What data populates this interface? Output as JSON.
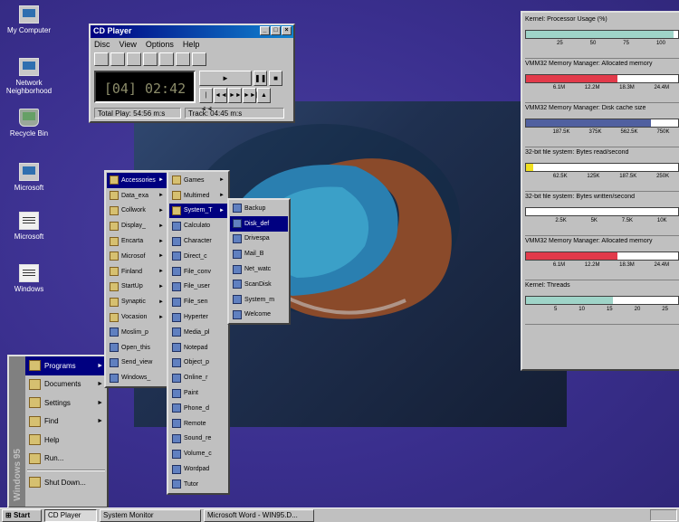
{
  "desktop": {
    "icons": [
      {
        "label": "My Computer"
      },
      {
        "label": "Network Neighborhood"
      },
      {
        "label": "Recycle Bin"
      },
      {
        "label": "Microsoft"
      },
      {
        "label": "Microsoft"
      },
      {
        "label": "Windows"
      }
    ]
  },
  "cd_player": {
    "title": "CD Player",
    "menu": [
      "Disc",
      "View",
      "Options",
      "Help"
    ],
    "display": "[04] 02:42",
    "status_total": "Total Play: 54:56 m:s",
    "status_track": "Track: 04:45 m:s"
  },
  "system_monitor": {
    "panels": [
      {
        "label": "Kernel: Processor Usage (%)",
        "ticks": [
          "25",
          "50",
          "75",
          "100"
        ],
        "fill": 0.97,
        "color": "#9fd4c8"
      },
      {
        "label": "VMM32 Memory Manager: Allocated memory",
        "ticks": [
          "6.1M",
          "12.2M",
          "18.3M",
          "24.4M"
        ],
        "fill": 0.6,
        "color": "#e23a4a"
      },
      {
        "label": "VMM32 Memory Manager: Disk cache size",
        "ticks": [
          "187.5K",
          "375K",
          "562.5K",
          "750K"
        ],
        "fill": 0.82,
        "color": "#5060a0"
      },
      {
        "label": "32-bit file system: Bytes read/second",
        "ticks": [
          "62.5K",
          "125K",
          "187.5K",
          "250K"
        ],
        "fill": 0.05,
        "color": "#f0e020"
      },
      {
        "label": "32-bit file system: Bytes written/second",
        "ticks": [
          "2.5K",
          "5K",
          "7.5K",
          "10K"
        ],
        "fill": 0.0,
        "color": "#9fd4c8"
      },
      {
        "label": "VMM32 Memory Manager: Allocated memory",
        "ticks": [
          "6.1M",
          "12.2M",
          "18.3M",
          "24.4M"
        ],
        "fill": 0.6,
        "color": "#e23a4a"
      },
      {
        "label": "Kernel: Threads",
        "ticks": [
          "5",
          "10",
          "15",
          "20",
          "25"
        ],
        "fill": 0.57,
        "color": "#9fd4c8"
      }
    ]
  },
  "start_menu": {
    "side_text": "Windows 95",
    "items": [
      {
        "label": "Programs",
        "arrow": true,
        "highlight": true
      },
      {
        "label": "Documents",
        "arrow": true
      },
      {
        "label": "Settings",
        "arrow": true
      },
      {
        "label": "Find",
        "arrow": true
      },
      {
        "label": "Help"
      },
      {
        "label": "Run..."
      },
      {
        "label": "Shut Down..."
      }
    ]
  },
  "programs_menu": {
    "items": [
      {
        "label": "Accessories",
        "arrow": true,
        "highlight": true
      },
      {
        "label": "Data_exa",
        "arrow": true
      },
      {
        "label": "Collwork",
        "arrow": true
      },
      {
        "label": "Display_",
        "arrow": true
      },
      {
        "label": "Encarta",
        "arrow": true
      },
      {
        "label": "Microsof",
        "arrow": true
      },
      {
        "label": "Finland",
        "arrow": true
      },
      {
        "label": "StartUp",
        "arrow": true
      },
      {
        "label": "Synaptic",
        "arrow": true
      },
      {
        "label": "Vocasion",
        "arrow": true
      },
      {
        "label": "Moslim_p"
      },
      {
        "label": "Open_this"
      },
      {
        "label": "Send_view"
      },
      {
        "label": "Windows_"
      }
    ]
  },
  "accessories_menu": {
    "items": [
      {
        "label": "Games",
        "arrow": true
      },
      {
        "label": "Multimed",
        "arrow": true
      },
      {
        "label": "System_T",
        "arrow": true,
        "highlight": true
      },
      {
        "label": "Calculato"
      },
      {
        "label": "Character"
      },
      {
        "label": "Direct_c"
      },
      {
        "label": "File_conv"
      },
      {
        "label": "File_user"
      },
      {
        "label": "File_sen"
      },
      {
        "label": "Hyperter"
      },
      {
        "label": "Media_pl"
      },
      {
        "label": "Notepad"
      },
      {
        "label": "Object_p"
      },
      {
        "label": "Online_r"
      },
      {
        "label": "Paint"
      },
      {
        "label": "Phone_d"
      },
      {
        "label": "Remote"
      },
      {
        "label": "Sound_re"
      },
      {
        "label": "Volume_c"
      },
      {
        "label": "Wordpad"
      },
      {
        "label": "Tutor"
      }
    ]
  },
  "system_tools_menu": {
    "items": [
      {
        "label": "Backup"
      },
      {
        "label": "Disk_def",
        "highlight": true
      },
      {
        "label": "Drivespa"
      },
      {
        "label": "Mail_B"
      },
      {
        "label": "Net_watc"
      },
      {
        "label": "ScanDisk"
      },
      {
        "label": "System_m"
      },
      {
        "label": "Welcome"
      }
    ]
  },
  "taskbar": {
    "start_label": "Start",
    "buttons": [
      {
        "label": "CD Player",
        "pressed": true
      },
      {
        "label": "System Monitor"
      },
      {
        "label": "Microsoft Word - WIN95.D..."
      }
    ]
  }
}
